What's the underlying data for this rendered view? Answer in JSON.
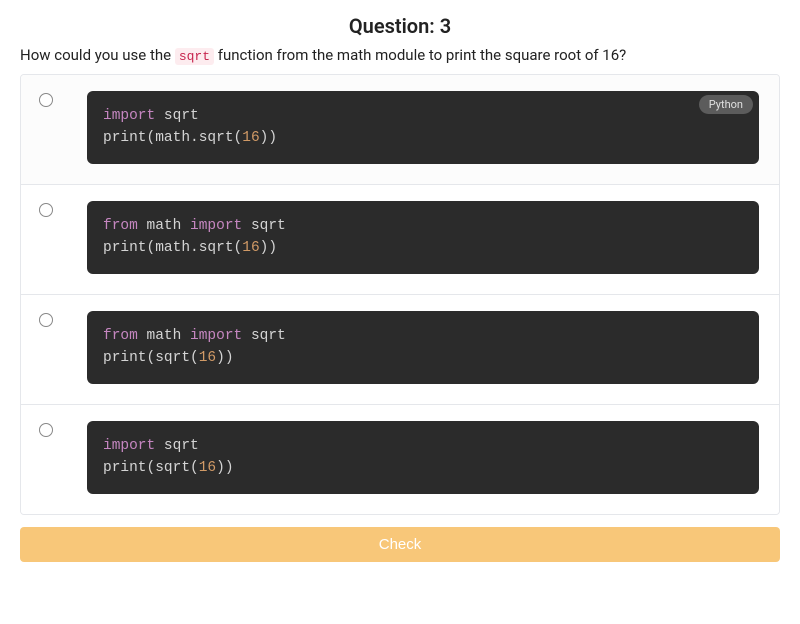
{
  "question": {
    "number_label": "Question: 3",
    "text_pre": "How could you use the ",
    "text_code": "sqrt",
    "text_post": " function from the math module to print the square root of 16?"
  },
  "language_badge": "Python",
  "options": [
    {
      "badge_visible": true,
      "tokens": [
        {
          "t": "import",
          "c": "kw"
        },
        {
          "t": " sqrt",
          "c": "mod"
        },
        {
          "t": "\n",
          "c": null
        },
        {
          "t": "print",
          "c": "func"
        },
        {
          "t": "(",
          "c": "paren"
        },
        {
          "t": "math.sqrt",
          "c": "mod"
        },
        {
          "t": "(",
          "c": "paren"
        },
        {
          "t": "16",
          "c": "num"
        },
        {
          "t": ")",
          "c": "paren"
        },
        {
          "t": ")",
          "c": "paren"
        }
      ]
    },
    {
      "badge_visible": false,
      "tokens": [
        {
          "t": "from",
          "c": "kw"
        },
        {
          "t": " math ",
          "c": "mod"
        },
        {
          "t": "import",
          "c": "kw"
        },
        {
          "t": " sqrt",
          "c": "mod"
        },
        {
          "t": "\n",
          "c": null
        },
        {
          "t": "print",
          "c": "func"
        },
        {
          "t": "(",
          "c": "paren"
        },
        {
          "t": "math.sqrt",
          "c": "mod"
        },
        {
          "t": "(",
          "c": "paren"
        },
        {
          "t": "16",
          "c": "num"
        },
        {
          "t": ")",
          "c": "paren"
        },
        {
          "t": ")",
          "c": "paren"
        }
      ]
    },
    {
      "badge_visible": false,
      "tokens": [
        {
          "t": "from",
          "c": "kw"
        },
        {
          "t": " math ",
          "c": "mod"
        },
        {
          "t": "import",
          "c": "kw"
        },
        {
          "t": " sqrt",
          "c": "mod"
        },
        {
          "t": "\n",
          "c": null
        },
        {
          "t": "print",
          "c": "func"
        },
        {
          "t": "(",
          "c": "paren"
        },
        {
          "t": "sqrt",
          "c": "mod"
        },
        {
          "t": "(",
          "c": "paren"
        },
        {
          "t": "16",
          "c": "num"
        },
        {
          "t": ")",
          "c": "paren"
        },
        {
          "t": ")",
          "c": "paren"
        }
      ]
    },
    {
      "badge_visible": false,
      "tokens": [
        {
          "t": "import",
          "c": "kw"
        },
        {
          "t": " sqrt",
          "c": "mod"
        },
        {
          "t": "\n",
          "c": null
        },
        {
          "t": "print",
          "c": "func"
        },
        {
          "t": "(",
          "c": "paren"
        },
        {
          "t": "sqrt",
          "c": "mod"
        },
        {
          "t": "(",
          "c": "paren"
        },
        {
          "t": "16",
          "c": "num"
        },
        {
          "t": ")",
          "c": "paren"
        },
        {
          "t": ")",
          "c": "paren"
        }
      ]
    }
  ],
  "check_button_label": "Check"
}
